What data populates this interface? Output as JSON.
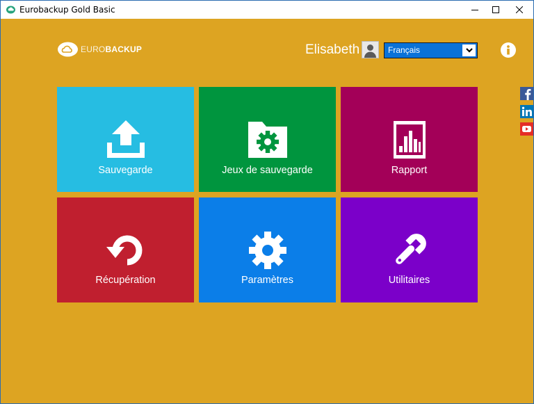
{
  "window": {
    "title": "Eurobackup Gold Basic",
    "controls": {
      "minimize_icon": "minimize-icon",
      "maximize_icon": "maximize-icon",
      "close_icon": "close-icon"
    }
  },
  "header": {
    "logo": {
      "euro": "EURO",
      "backup": "BACKUP",
      "icon": "cloud-icon"
    },
    "username": "Elisabeth",
    "avatar_icon": "user-icon",
    "language": {
      "selected": "Français",
      "arrow_icon": "chevron-down-icon"
    },
    "info_icon": "info-icon"
  },
  "social": [
    {
      "icon": "facebook-icon",
      "color": "#3b5998"
    },
    {
      "icon": "linkedin-icon",
      "color": "#0077b5"
    },
    {
      "icon": "youtube-icon",
      "color": "#e52d27"
    }
  ],
  "tiles": [
    {
      "label": "Sauvegarde",
      "icon": "upload-icon",
      "color": "#26bde2"
    },
    {
      "label": "Jeux de sauvegarde",
      "icon": "folder-gear-icon",
      "color": "#00953e"
    },
    {
      "label": "Rapport",
      "icon": "report-chart-icon",
      "color": "#a30058"
    },
    {
      "label": "Récupération",
      "icon": "restore-icon",
      "color": "#c01f2f"
    },
    {
      "label": "Paramètres",
      "icon": "gear-icon",
      "color": "#0b7ee8"
    },
    {
      "label": "Utilitaires",
      "icon": "wrench-icon",
      "color": "#7b00c9"
    }
  ],
  "colors": {
    "background": "#dda422",
    "accent": "#0a72d8"
  }
}
